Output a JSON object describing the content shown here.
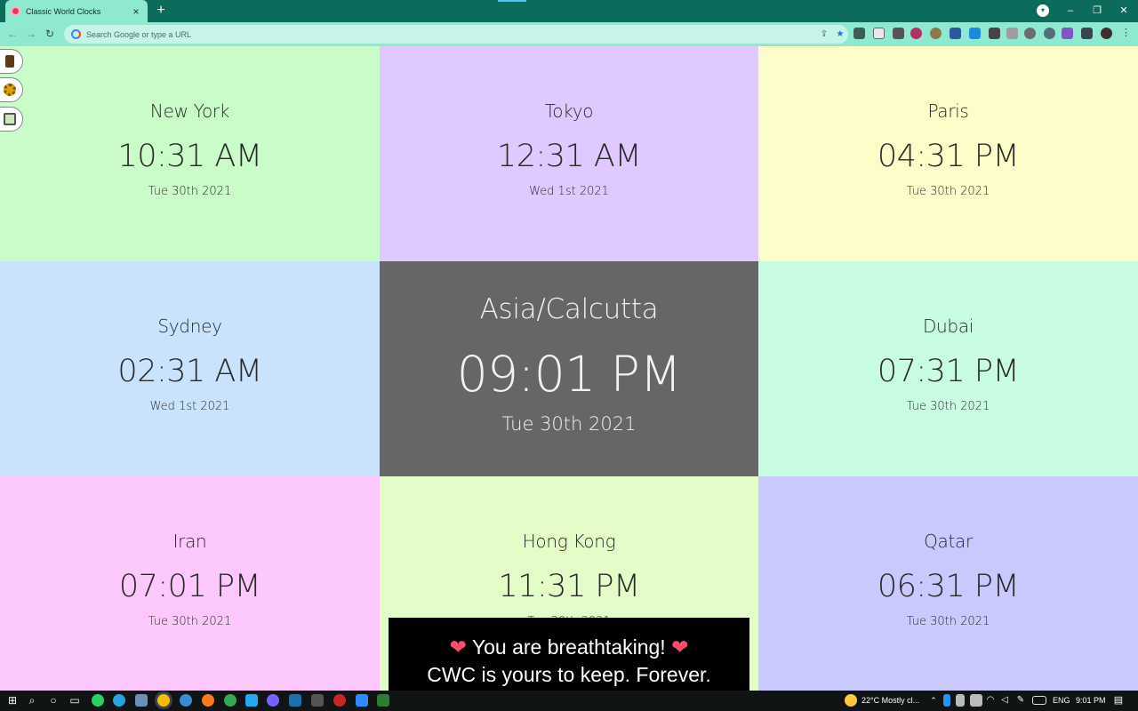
{
  "browser": {
    "tab_title": "Classic World Clocks",
    "tab_close": "×",
    "new_tab": "+",
    "omnibox_placeholder": "Search Google or type a URL",
    "window_controls": {
      "minimize": "–",
      "restore": "❐",
      "close": "✕"
    }
  },
  "side_buttons": [
    {
      "name": "coffee-icon"
    },
    {
      "name": "settings-gear-icon"
    },
    {
      "name": "edit-pencil-icon"
    }
  ],
  "clocks": [
    {
      "city": "New York",
      "time": "10:31 AM",
      "date": "Tue 30th 2021",
      "color": "#c9fcc8"
    },
    {
      "city": "Tokyo",
      "time": "12:31 AM",
      "date": "Wed 1st 2021",
      "color": "#e0c9fe"
    },
    {
      "city": "Paris",
      "time": "04:31 PM",
      "date": "Tue 30th 2021",
      "color": "#fdfdc9"
    },
    {
      "city": "Sydney",
      "time": "02:31 AM",
      "date": "Wed 1st 2021",
      "color": "#c9e3fd"
    },
    {
      "city": "Asia/Calcutta",
      "time": "09:01 PM",
      "date": "Tue 30th 2021",
      "color": "#666666",
      "featured": true
    },
    {
      "city": "Dubai",
      "time": "07:31 PM",
      "date": "Tue 30th 2021",
      "color": "#c9fde3"
    },
    {
      "city": "Iran",
      "time": "07:01 PM",
      "date": "Tue 30th 2021",
      "color": "#fdc9fd"
    },
    {
      "city": "Hong Kong",
      "time": "11:31 PM",
      "date": "Tue 30th 2021",
      "color": "#e3fdc9"
    },
    {
      "city": "Qatar",
      "time": "06:31 PM",
      "date": "Tue 30th 2021",
      "color": "#c9c9fd"
    }
  ],
  "toast": {
    "line1": "You are breathtaking!",
    "heart": "❤",
    "line2": "CWC is yours to keep. Forever."
  },
  "taskbar": {
    "weather": "22°C  Mostly cl...",
    "language": "ENG",
    "clock": "9:01 PM"
  },
  "colors": {
    "browser_frame": "#0c6b5a",
    "toolbar": "#8fe8d0",
    "omnibox": "#c6f4e8"
  }
}
